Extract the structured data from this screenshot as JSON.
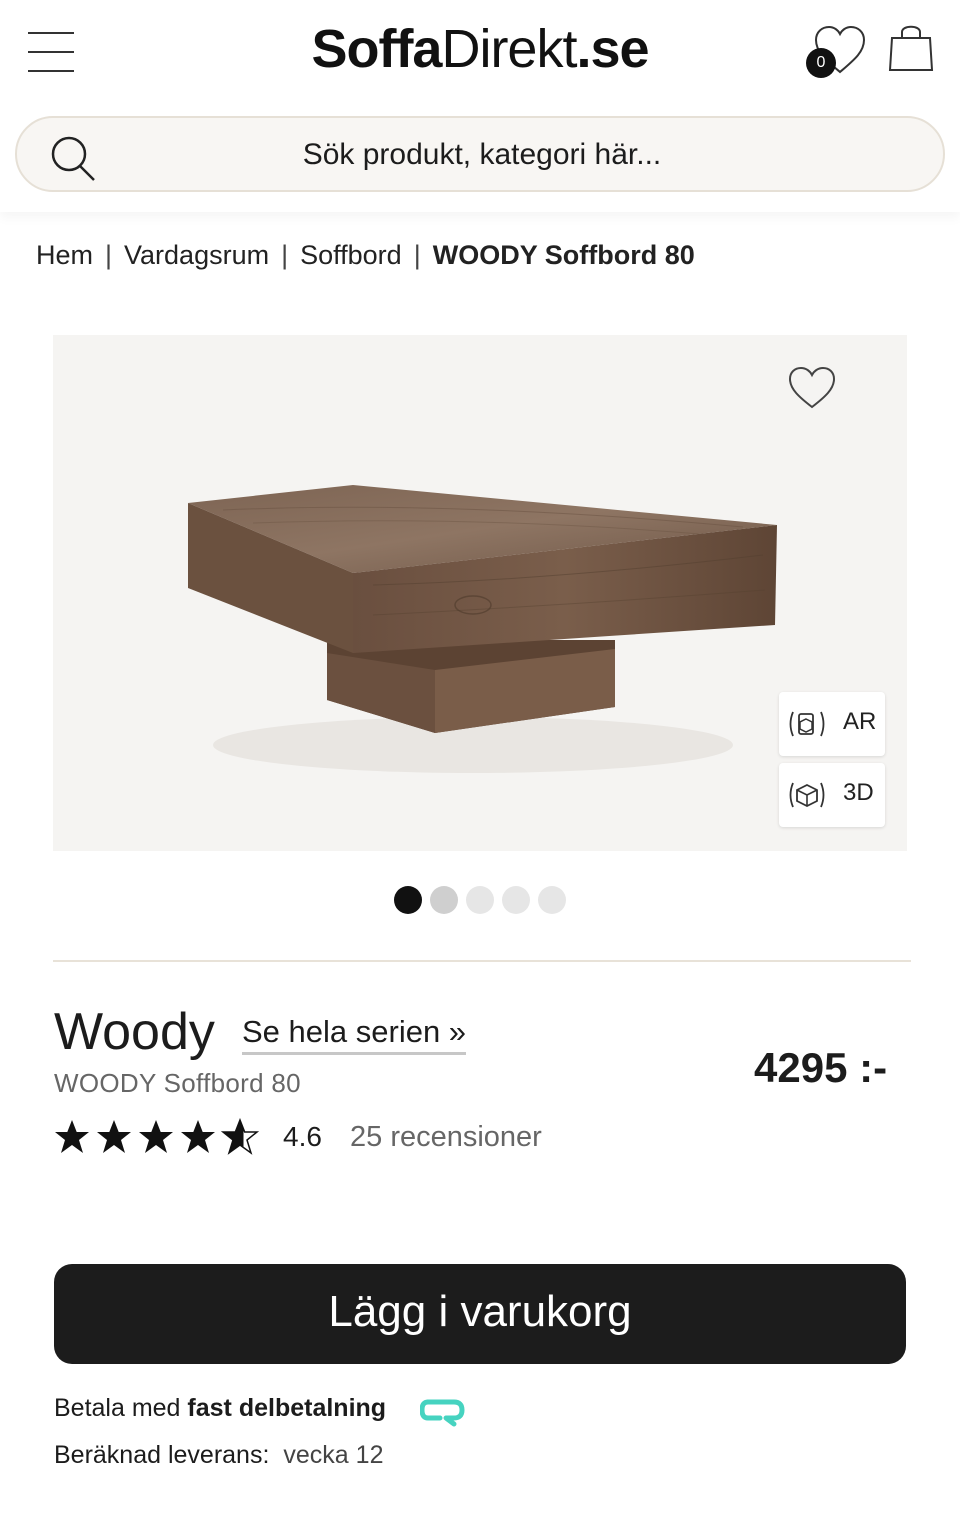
{
  "header": {
    "logo_bold": "Soffa",
    "logo_light": "Direkt",
    "logo_bold_tail": ".se",
    "wishlist_count": "0",
    "search_placeholder": "Sök produkt, kategori här..."
  },
  "breadcrumb": {
    "items": [
      "Hem",
      "Vardagsrum",
      "Soffbord"
    ],
    "current": "WOODY Soffbord 80",
    "separator": "|"
  },
  "gallery": {
    "ar_label": "AR",
    "td_label": "3D",
    "dot_count": 5,
    "active_dot": 0
  },
  "product": {
    "series_name": "Woody",
    "series_link": "Se hela serien »",
    "subtitle": "WOODY Soffbord 80",
    "price": "4295 :-",
    "rating": "4.6",
    "reviews": "25 recensioner",
    "stars_filled": 4.6
  },
  "actions": {
    "add_to_cart": "Lägg i varukorg"
  },
  "payment": {
    "prefix": "Betala med",
    "method": "fast delbetalning",
    "qliro_color": "#46d3c0"
  },
  "delivery": {
    "label": "Beräknad leverans:",
    "value": "vecka 12"
  }
}
